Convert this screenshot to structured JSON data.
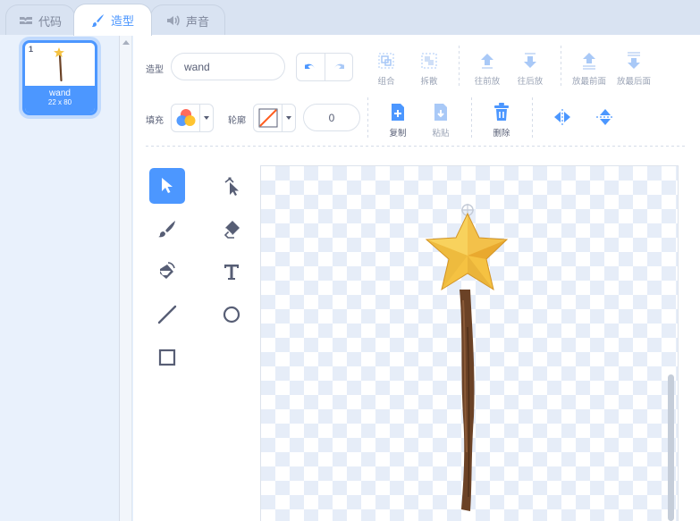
{
  "tabs": [
    {
      "label": "代码",
      "icon": "code-icon",
      "active": false
    },
    {
      "label": "造型",
      "icon": "brush-icon",
      "active": true
    },
    {
      "label": "声音",
      "icon": "speaker-icon",
      "active": false
    }
  ],
  "costume_list": {
    "items": [
      {
        "number": "1",
        "name": "wand",
        "size": "22 x 80",
        "selected": true
      }
    ]
  },
  "editor": {
    "costume_label": "造型",
    "costume_name": "wand",
    "undo_icon": "undo-icon",
    "redo_icon": "redo-icon",
    "toolbar": {
      "group": "组合",
      "ungroup": "拆散",
      "forward": "往前放",
      "backward": "往后放",
      "front": "放最前面",
      "back": "放最后面",
      "copy": "复制",
      "paste": "粘贴",
      "delete": "删除"
    },
    "fill_label": "填充",
    "outline_label": "轮廓",
    "outline_width": "0",
    "tools": [
      "select-tool",
      "reshape-tool",
      "brush-tool",
      "eraser-tool",
      "fill-tool",
      "text-tool",
      "line-tool",
      "circle-tool",
      "rectangle-tool"
    ],
    "active_tool": "select-tool",
    "canvas_sprite": "wand"
  },
  "colors": {
    "accent": "#4c97ff",
    "text": "#575e75",
    "star": "#f5c242",
    "stick": "#6b4226"
  }
}
